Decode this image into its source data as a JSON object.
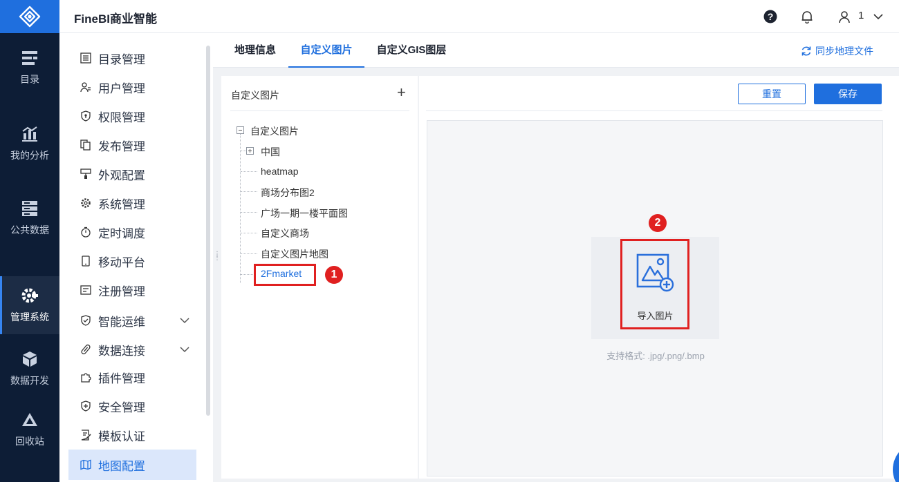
{
  "header": {
    "title": "FineBI商业智能",
    "user": "1"
  },
  "rail": {
    "items": [
      {
        "label": "目录"
      },
      {
        "label": "我的分析"
      },
      {
        "label": "公共数据"
      },
      {
        "label": "管理系统"
      },
      {
        "label": "数据开发"
      },
      {
        "label": "回收站"
      }
    ]
  },
  "menu": {
    "items": [
      {
        "label": "目录管理"
      },
      {
        "label": "用户管理"
      },
      {
        "label": "权限管理"
      },
      {
        "label": "发布管理"
      },
      {
        "label": "外观配置"
      },
      {
        "label": "系统管理"
      },
      {
        "label": "定时调度"
      },
      {
        "label": "移动平台"
      },
      {
        "label": "注册管理"
      },
      {
        "label": "智能运维"
      },
      {
        "label": "数据连接"
      },
      {
        "label": "插件管理"
      },
      {
        "label": "安全管理"
      },
      {
        "label": "模板认证"
      },
      {
        "label": "地图配置"
      }
    ]
  },
  "tabs": [
    {
      "label": "地理信息"
    },
    {
      "label": "自定义图片"
    },
    {
      "label": "自定义GIS图层"
    }
  ],
  "sync_label": "同步地理文件",
  "tree": {
    "heading": "自定义图片",
    "add": "+",
    "root": "自定义图片",
    "children": [
      "中国",
      "heatmap",
      "商场分布图2",
      "广场一期一楼平面图",
      "自定义商场",
      "自定义图片地图",
      "2Fmarket"
    ]
  },
  "buttons": {
    "reset": "重置",
    "save": "保存"
  },
  "import": {
    "label": "导入图片",
    "formats": "支持格式: .jpg/.png/.bmp"
  },
  "badges": {
    "one": "1",
    "two": "2"
  },
  "colors": {
    "accent": "#1f6fde",
    "rail": "#0d1d36",
    "highlight": "#e02020"
  }
}
